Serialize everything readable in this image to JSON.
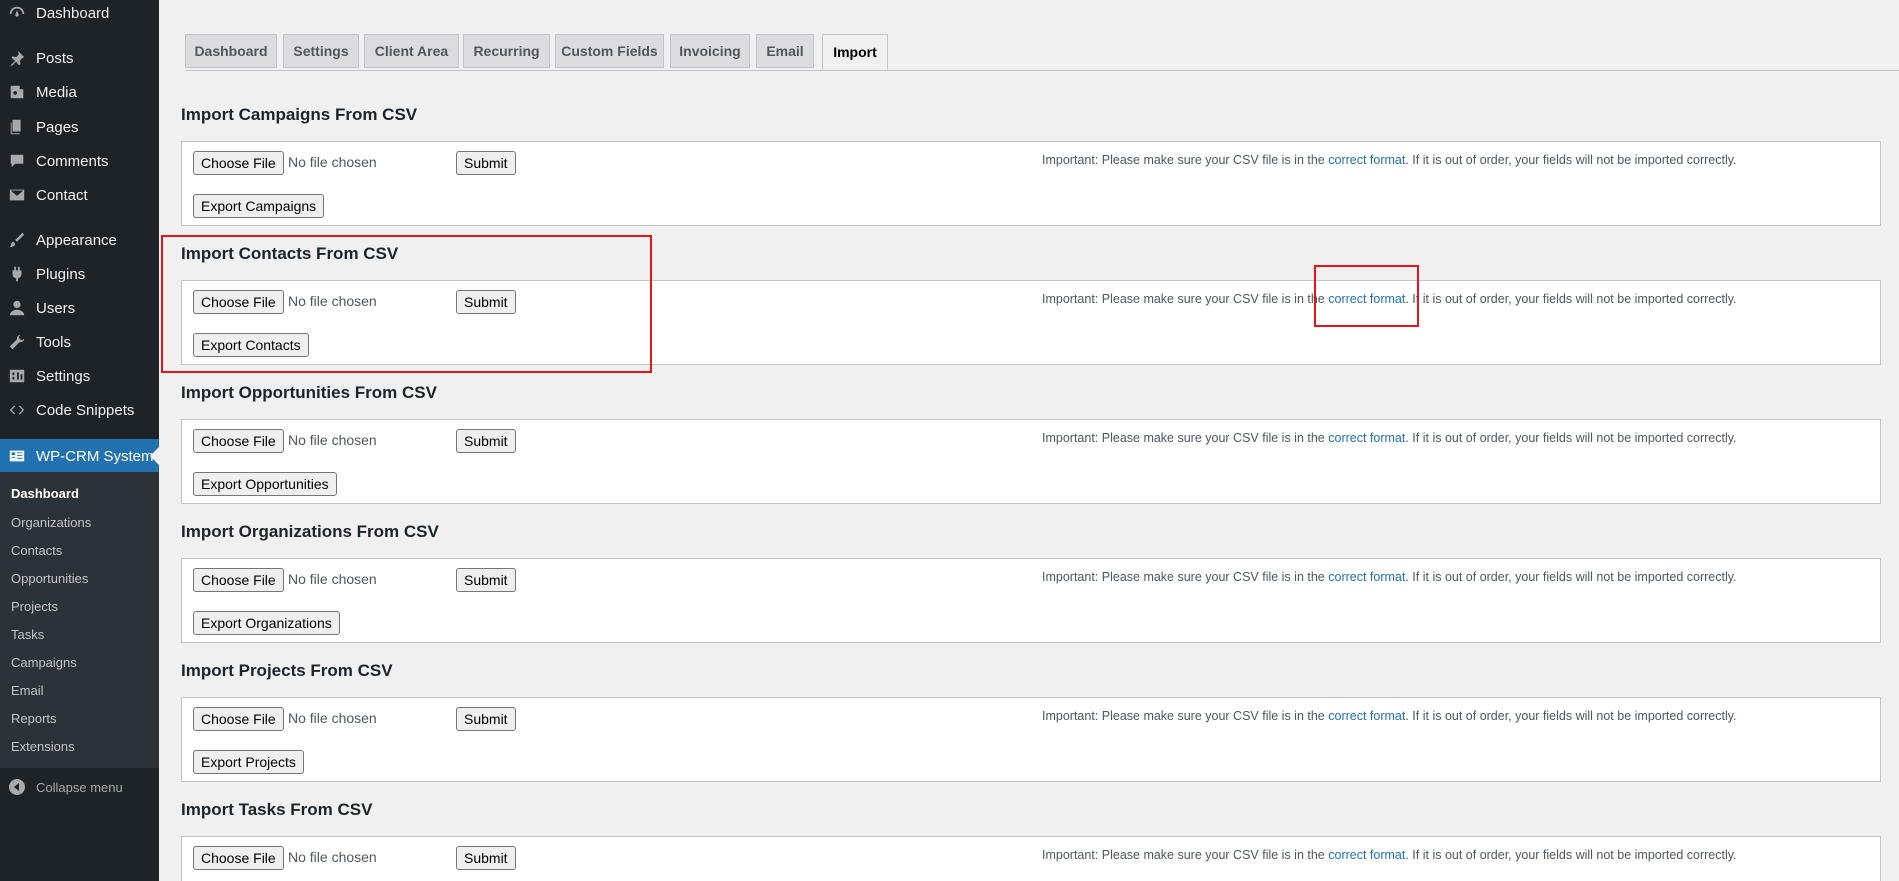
{
  "sidebar": {
    "items": [
      {
        "label": "Dashboard",
        "icon": "dashboard-icon"
      },
      {
        "label": "Posts",
        "icon": "pin-icon"
      },
      {
        "label": "Media",
        "icon": "media-icon"
      },
      {
        "label": "Pages",
        "icon": "pages-icon"
      },
      {
        "label": "Comments",
        "icon": "comment-icon"
      },
      {
        "label": "Contact",
        "icon": "mail-icon"
      },
      {
        "label": "Appearance",
        "icon": "brush-icon"
      },
      {
        "label": "Plugins",
        "icon": "plug-icon"
      },
      {
        "label": "Users",
        "icon": "user-icon"
      },
      {
        "label": "Tools",
        "icon": "wrench-icon"
      },
      {
        "label": "Settings",
        "icon": "settings-icon"
      },
      {
        "label": "Code Snippets",
        "icon": "code-icon"
      },
      {
        "label": "WP-CRM System",
        "icon": "crm-icon"
      }
    ],
    "submenu": [
      "Dashboard",
      "Organizations",
      "Contacts",
      "Opportunities",
      "Projects",
      "Tasks",
      "Campaigns",
      "Email",
      "Reports",
      "Extensions"
    ],
    "collapse_label": "Collapse menu"
  },
  "tabs": [
    "Dashboard",
    "Settings",
    "Client Area",
    "Recurring",
    "Custom Fields",
    "Invoicing",
    "Email",
    "Import"
  ],
  "active_tab": "Import",
  "common": {
    "choose_file": "Choose File",
    "no_file": "No file chosen",
    "submit": "Submit",
    "note_before": "Important: Please make sure your CSV file is in the ",
    "note_link": "correct format",
    "note_after": ". If it is out of order, your fields will not be imported correctly."
  },
  "sections": [
    {
      "title": "Import Campaigns From CSV",
      "export": "Export Campaigns"
    },
    {
      "title": "Import Contacts From CSV",
      "export": "Export Contacts"
    },
    {
      "title": "Import Opportunities From CSV",
      "export": "Export Opportunities"
    },
    {
      "title": "Import Organizations From CSV",
      "export": "Export Organizations"
    },
    {
      "title": "Import Projects From CSV",
      "export": "Export Projects"
    },
    {
      "title": "Import Tasks From CSV",
      "export": ""
    }
  ],
  "colors": {
    "accent": "#2271b1",
    "sidebar": "#1d2327",
    "highlight": "#e8141b"
  }
}
